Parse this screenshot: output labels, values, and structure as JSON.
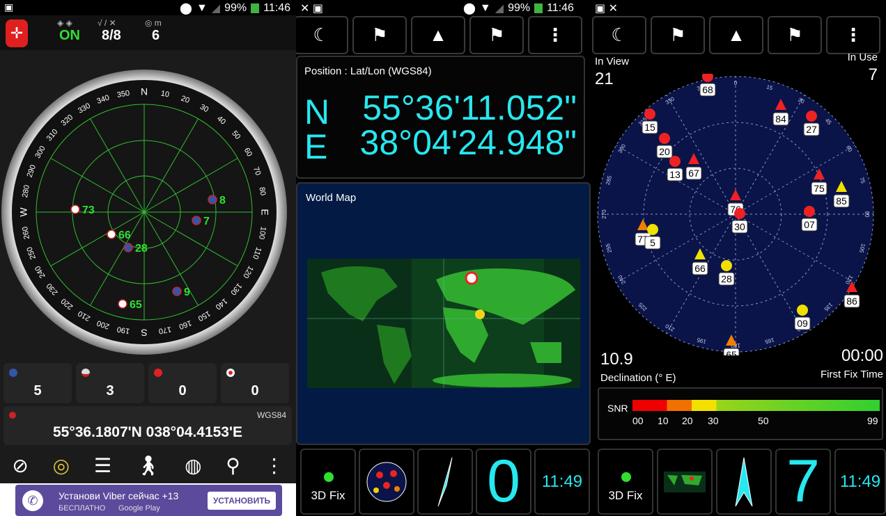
{
  "status": {
    "battery": "99%",
    "time": "11:46"
  },
  "left": {
    "gps_on": "ON",
    "sats_label": "8/8",
    "alt_value": "6",
    "hdr_icons": {
      "a": "◈ ◈",
      "b": "√ / ✕",
      "c": "◎ m"
    },
    "compass_degrees": [
      "340",
      "350",
      "N",
      "10",
      "20",
      "30",
      "40",
      "50",
      "60",
      "70",
      "80",
      "E",
      "100",
      "110",
      "120",
      "130",
      "140",
      "150",
      "160",
      "170",
      "S",
      "190",
      "200",
      "210",
      "220",
      "230",
      "240",
      "250",
      "260",
      "W",
      "280",
      "290",
      "300",
      "310",
      "320",
      "330"
    ],
    "satellites": [
      {
        "id": "8",
        "flag": "us"
      },
      {
        "id": "7",
        "flag": "us"
      },
      {
        "id": "73",
        "flag": "ru"
      },
      {
        "id": "66",
        "flag": "ru"
      },
      {
        "id": "28",
        "flag": "us"
      },
      {
        "id": "9",
        "flag": "us"
      },
      {
        "id": "65",
        "flag": "ru"
      }
    ],
    "counts": [
      {
        "flag": "us",
        "value": "5"
      },
      {
        "flag": "ru",
        "value": "3"
      },
      {
        "flag": "cn",
        "value": "0"
      },
      {
        "flag": "jp",
        "value": "0"
      }
    ],
    "datum": "WGS84",
    "coords": "55°36.1807'N  038°04.4153'E",
    "bottom_icons": [
      "compass-icon",
      "radar-icon",
      "list-icon",
      "walk-icon",
      "globe-icon",
      "location-pin-icon",
      "more-icon"
    ],
    "ad_text": "Установи Viber сейчас +13",
    "ad_sub": "БЕСПЛАТНО",
    "ad_store": "Google Play",
    "ad_button": "УСТАНОВИТЬ"
  },
  "middle": {
    "toolbar": [
      "moon-icon",
      "people-flag-icon",
      "arrow-icon",
      "flags-icon",
      "more-icon"
    ],
    "position_label": "Position : Lat/Lon (WGS84)",
    "lat_dir": "N",
    "lat": "55°36'11.052\"",
    "lon_dir": "E",
    "lon": "38°04'24.948\"",
    "map_label": "World Map",
    "fix_label": "3D Fix",
    "big_number": "0",
    "time": "11:49"
  },
  "right": {
    "in_view_label": "In View",
    "in_view": "21",
    "in_use_label": "In Use",
    "in_use": "7",
    "skyplot_degrees": [
      "345",
      "0",
      "15",
      "30",
      "45",
      "60",
      "75",
      "90",
      "105",
      "120",
      "135",
      "150",
      "165",
      "180",
      "195",
      "210",
      "225",
      "240",
      "255",
      "270",
      "285",
      "300",
      "315",
      "330"
    ],
    "sats": [
      "68",
      "84",
      "15",
      "27",
      "20",
      "13",
      "67",
      "75",
      "85",
      "76",
      "07",
      "30",
      "77",
      "5",
      "66",
      "28",
      "86",
      "09",
      "65"
    ],
    "declination_value": "10.9",
    "declination_label": "Declination (° E)",
    "first_fix_value": "00:00",
    "first_fix_label": "First Fix Time",
    "snr_label": "SNR",
    "snr_ticks": [
      "00",
      "10",
      "20",
      "30",
      "50",
      "99"
    ],
    "fix_label": "3D Fix",
    "big_number": "7",
    "time": "11:49"
  }
}
